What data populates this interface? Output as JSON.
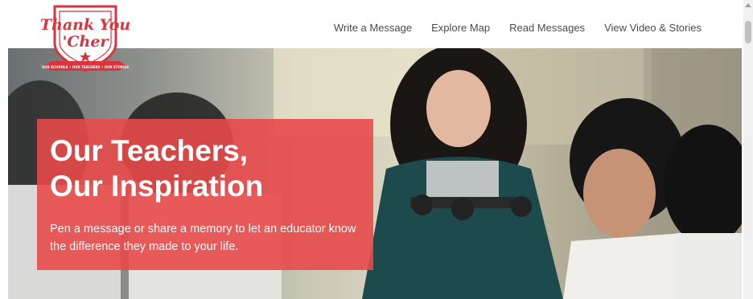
{
  "brand": {
    "logo_line1": "Thank You",
    "logo_line2": "'Cher",
    "ribbon_text": "OUR SCHOOLS • OUR TEACHERS • OUR STORIES"
  },
  "nav": {
    "items": [
      "Write a Message",
      "Explore Map",
      "Read Messages",
      "View Video & Stories"
    ]
  },
  "hero": {
    "title_line1": "Our Teachers,",
    "title_line2": "Our Inspiration",
    "subtitle_line1": "Pen a message or share a memory to let an educator know",
    "subtitle_line2": "the difference they made to your life."
  },
  "colors": {
    "brand_red": "#d8353f",
    "caption_red": "#e84a4a"
  }
}
